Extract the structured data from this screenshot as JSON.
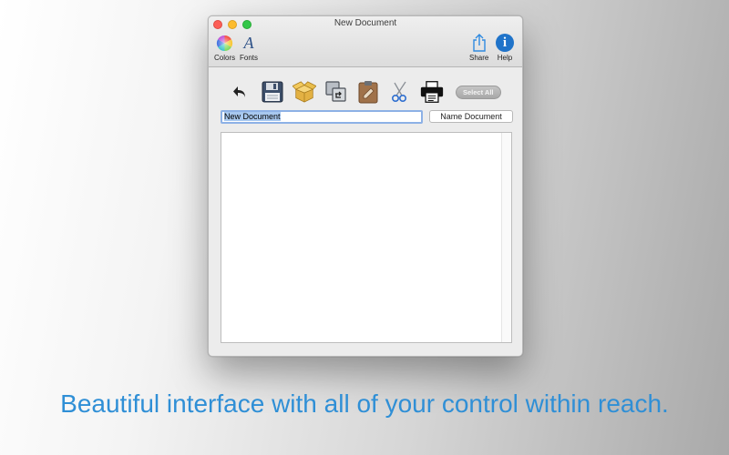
{
  "window": {
    "title": "New Document"
  },
  "toolbar": {
    "colors_label": "Colors",
    "fonts_label": "Fonts",
    "fonts_glyph": "A",
    "share_label": "Share",
    "help_label": "Help",
    "help_glyph": "i"
  },
  "actions": {
    "select_all_label": "Select All"
  },
  "document": {
    "name_value": "New Document",
    "name_button_label": "Name Document"
  },
  "caption": "Beautiful interface with all of your control within reach.",
  "colors": {
    "accent": "#2f8fd6",
    "help_blue": "#1f73c9",
    "close": "#fc5f57",
    "minimize": "#fdbc2e",
    "maximize": "#33c748"
  }
}
